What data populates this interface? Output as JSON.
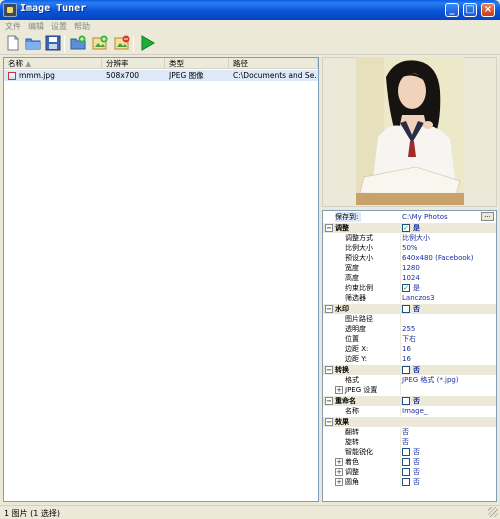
{
  "window": {
    "title": "Image Tuner"
  },
  "menu": [
    "文件",
    "编辑",
    "设置",
    "帮助"
  ],
  "toolbar": {
    "buttons": [
      "new-icon",
      "open-folder-icon",
      "save-icon",
      "add-folder-icon",
      "add-image-icon",
      "remove-image-icon",
      "run-icon"
    ]
  },
  "filelist": {
    "columns": [
      "名称",
      "分辨率",
      "类型",
      "路径"
    ],
    "rows": [
      {
        "name": "mmm.jpg",
        "resolution": "508x700",
        "type": "JPEG 图像",
        "path": "C:\\Documents and Se..."
      }
    ]
  },
  "properties": {
    "save_to": {
      "label": "保存到:",
      "value": "C:\\My Photos",
      "button": "..."
    },
    "adjust": {
      "title": "调整",
      "enabled_label": "是",
      "mode": {
        "label": "调整方式",
        "value": "比例大小"
      },
      "scale": {
        "label": "比例大小",
        "value": "50%"
      },
      "preset": {
        "label": "预设大小",
        "value": "640x480 (Facebook)"
      },
      "width": {
        "label": "宽度",
        "value": "1280"
      },
      "height": {
        "label": "高度",
        "value": "1024"
      },
      "constrain": {
        "label": "约束比例",
        "value": "是"
      },
      "filter": {
        "label": "筛选器",
        "value": "Lanczos3"
      }
    },
    "watermark": {
      "title": "水印",
      "enabled_label": "否",
      "image_path": {
        "label": "图片路径",
        "value": ""
      },
      "opacity": {
        "label": "透明度",
        "value": "255"
      },
      "position": {
        "label": "位置",
        "value": "下右"
      },
      "margin_x": {
        "label": "边距 X:",
        "value": "16"
      },
      "margin_y": {
        "label": "边距 Y:",
        "value": "16"
      }
    },
    "convert": {
      "title": "转换",
      "enabled_label": "否",
      "format": {
        "label": "格式",
        "value": "JPEG 格式 (*.jpg)"
      },
      "jpeg": {
        "label": "JPEG 设置"
      }
    },
    "rename": {
      "title": "重命名",
      "enabled_label": "否",
      "name": {
        "label": "名称",
        "value": "Image_"
      }
    },
    "effects": {
      "title": "效果",
      "flip": {
        "label": "翻转",
        "value": "否"
      },
      "rotate": {
        "label": "旋转",
        "value": "否"
      },
      "sharpen": {
        "label": "智能锐化",
        "value": "否"
      },
      "color": {
        "label": "着色",
        "value": "否"
      },
      "adjust": {
        "label": "调整",
        "value": "否"
      },
      "corners": {
        "label": "圆角",
        "value": "否"
      }
    }
  },
  "status": {
    "text": "1 图片 (1 选择)"
  },
  "colors": {
    "title_blue": "#0854d8",
    "value_blue": "#1a2fa0",
    "check_green": "#21a121",
    "selection": "#dde8f8"
  }
}
